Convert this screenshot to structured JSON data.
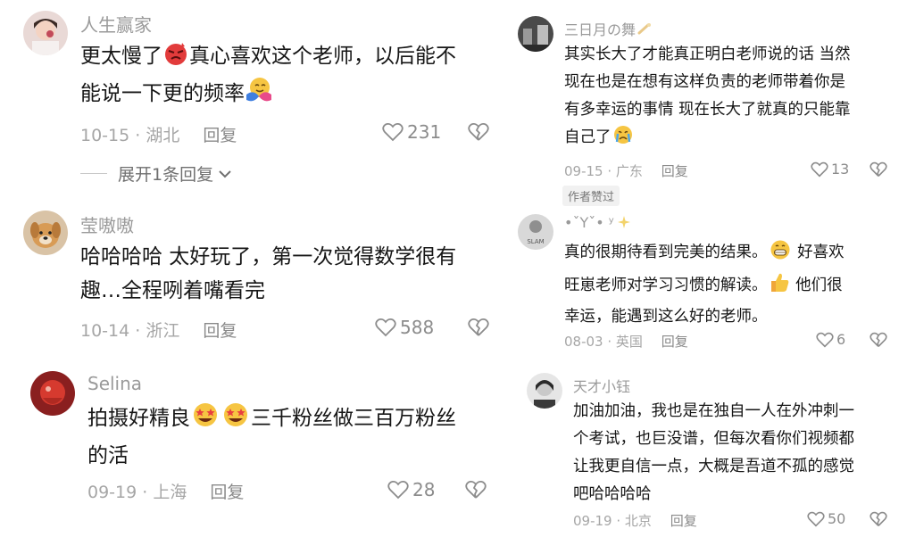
{
  "comments_left": [
    {
      "username": "人生赢家",
      "text_lines": [
        "更太慢了",
        "真心喜欢这个老师，以后能不",
        "能说一下更的频率"
      ],
      "date_location": "10-15 · 湖北",
      "reply_label": "回复",
      "likes": "231",
      "expand_label": "展开1条回复"
    },
    {
      "username": "莹嗷嗷",
      "text_lines": [
        "哈哈哈哈 太好玩了，第一次觉得数学很有",
        "趣…全程咧着嘴看完"
      ],
      "date_location": "10-14 · 浙江",
      "reply_label": "回复",
      "likes": "588"
    },
    {
      "username": "Selina",
      "text_lines": [
        "拍摄好精良",
        "三千粉丝做三百万粉丝",
        "的活"
      ],
      "date_location": "09-19 · 上海",
      "reply_label": "回复",
      "likes": "28"
    }
  ],
  "comments_right": [
    {
      "username": "三日月の舞",
      "text_lines": [
        "其实长大了才能真正明白老师说的话 当然",
        "现在也是在想有这样负责的老师带着你是",
        "有多幸运的事情 现在长大了就真的只能靠",
        "自己了"
      ],
      "date_location": "09-15 · 广东",
      "reply_label": "回复",
      "likes": "13",
      "badge": "作者赞过"
    },
    {
      "username": "•ˇYˇ• ʸ",
      "avatar_text": "SLAM",
      "text_lines": [
        "真的很期待看到完美的结果。",
        " 好喜欢",
        "旺崽老师对学习习惯的解读。",
        " 他们很",
        "幸运，能遇到这么好的老师。"
      ],
      "date_location": "08-03 · 英国",
      "reply_label": "回复",
      "likes": "6"
    },
    {
      "username": "天才小钰",
      "text_lines": [
        "加油加油，我也是在独自一人在外冲刺一",
        "个考试，也巨没谱，但每次看你们视频都",
        "让我更自信一点，大概是吾道不孤的感觉",
        "吧哈哈哈哈"
      ],
      "date_location": "09-19 · 北京",
      "reply_label": "回复",
      "likes": "50"
    }
  ],
  "icons": {
    "like": "heart-outline-icon",
    "dislike": "broken-heart-icon",
    "expand": "chevron-down-icon"
  },
  "colors": {
    "text": "#161616",
    "meta": "#a6a6a6",
    "username": "#9a9a9a"
  }
}
